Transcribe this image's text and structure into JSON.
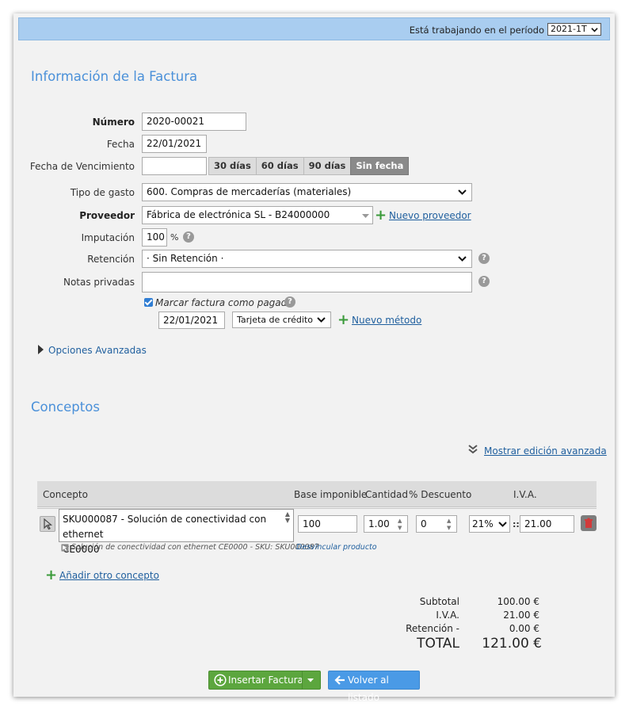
{
  "header": {
    "period_label": "Está trabajando en el período",
    "period_value": "2021-1T"
  },
  "invoice": {
    "title": "Información de la Factura",
    "numero_label": "Número",
    "numero_value": "2020-00021",
    "fecha_label": "Fecha",
    "fecha_value": "22/01/2021",
    "vencimiento_label": "Fecha de Vencimiento",
    "vencimiento_value": "",
    "due_options": [
      "30 días",
      "60 días",
      "90 días",
      "Sin fecha"
    ],
    "due_selected": "Sin fecha",
    "tipo_gasto_label": "Tipo de gasto",
    "tipo_gasto_value": "600. Compras de mercaderías (materiales)",
    "proveedor_label": "Proveedor",
    "proveedor_value": "Fábrica de electrónica SL - B24000000",
    "nuevo_proveedor": "Nuevo proveedor",
    "imputacion_label": "Imputación",
    "imputacion_value": "100",
    "imputacion_unit": "%",
    "retencion_label": "Retención",
    "retencion_value": "· Sin Retención ·",
    "notas_label": "Notas privadas",
    "notas_value": "",
    "pagada_label": "Marcar factura como pagada",
    "pagada_checked": true,
    "pago_fecha": "22/01/2021",
    "pago_metodo": "Tarjeta de crédito",
    "nuevo_metodo": "Nuevo método",
    "opciones_avanzadas": "Opciones Avanzadas"
  },
  "concepts": {
    "title": "Conceptos",
    "advanced_link": "Mostrar edición avanzada",
    "columns": [
      "Concepto",
      "Base imponible",
      "Cantidad",
      "% Descuento",
      "I.V.A."
    ],
    "rows": [
      {
        "concepto_line1": "SKU000087 - Solución de conectividad con ethernet",
        "concepto_line2": "CE0000",
        "base": "100",
        "cantidad": "1.00",
        "descuento": "0",
        "iva_pct": "21%",
        "iva_sep": "::",
        "iva_value": "21.00",
        "product_note": "Solución de conectividad con ethernet CE0000 - SKU: SKU000087",
        "unlink": "Desvincular producto"
      }
    ],
    "add_concept": "Añadir otro concepto"
  },
  "totals": {
    "subtotal_label": "Subtotal",
    "subtotal_value": "100.00 €",
    "iva_label": "I.V.A.",
    "iva_value": "21.00 €",
    "retencion_label": "Retención -",
    "retencion_value": "0.00 €",
    "total_label": "TOTAL",
    "total_value": "121.00 €"
  },
  "actions": {
    "insert_label": "Insertar Factura",
    "back_label": "Volver al listado"
  },
  "colors": {
    "topbar": "#a9cdf0",
    "title_blue": "#4a90d9",
    "green": "#5ca63e",
    "blue_button": "#4a9ae6",
    "link": "#1f5f9e"
  }
}
